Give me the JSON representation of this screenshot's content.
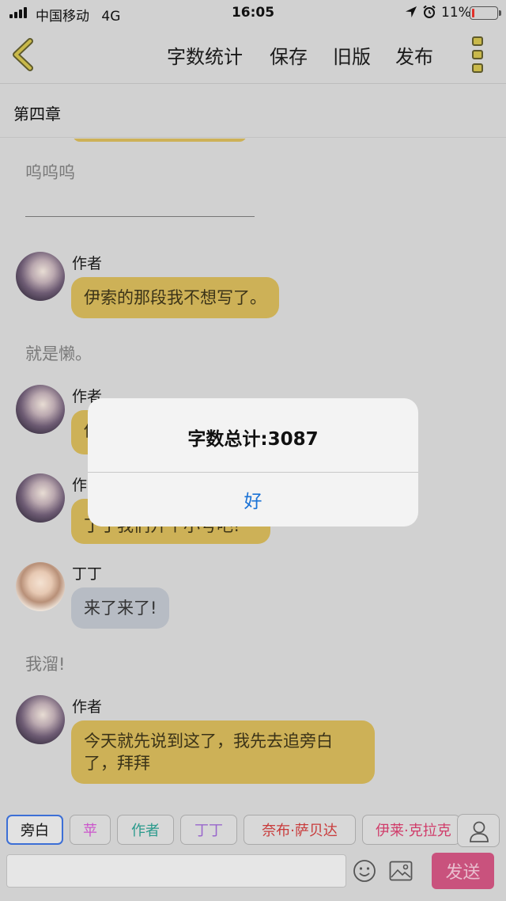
{
  "status_bar": {
    "carrier": "中国移动",
    "network": "4G",
    "time": "16:05",
    "battery": "11%",
    "battery_level": 0.11
  },
  "nav": {
    "word_count": "字数统计",
    "save": "保存",
    "old_version": "旧版",
    "publish": "发布"
  },
  "chapter": {
    "title": "第四章"
  },
  "messages": {
    "narration_1": "呜呜呜",
    "divider": "—————————————",
    "msg1_speaker": "作者",
    "msg1_text": "伊索的那段我不想写了。",
    "narration_2": "就是懒。",
    "msg2_speaker": "作者",
    "msg2_text": "他",
    "msg3_speaker": "作",
    "msg3_text": "丁丁我们开个小号吧!",
    "msg4_speaker": "丁丁",
    "msg4_text": "来了来了!",
    "narration_3": "我溜!",
    "msg5_speaker": "作者",
    "msg5_text": "今天就先说到这了，我先去追旁白了，拜拜"
  },
  "characters": [
    {
      "label": "旁白",
      "color": "#111111"
    },
    {
      "label": "苹",
      "color": "#cc55cc"
    },
    {
      "label": "作者",
      "color": "#2a9a8c"
    },
    {
      "label": "丁丁",
      "color": "#9966cc"
    },
    {
      "label": "奈布·萨贝达",
      "color": "#c83a3a"
    },
    {
      "label": "伊莱·克拉克",
      "color": "#d03c6a"
    }
  ],
  "input": {
    "placeholder": "",
    "send": "发送"
  },
  "alert": {
    "title": "字数总计:3087",
    "ok": "好"
  }
}
